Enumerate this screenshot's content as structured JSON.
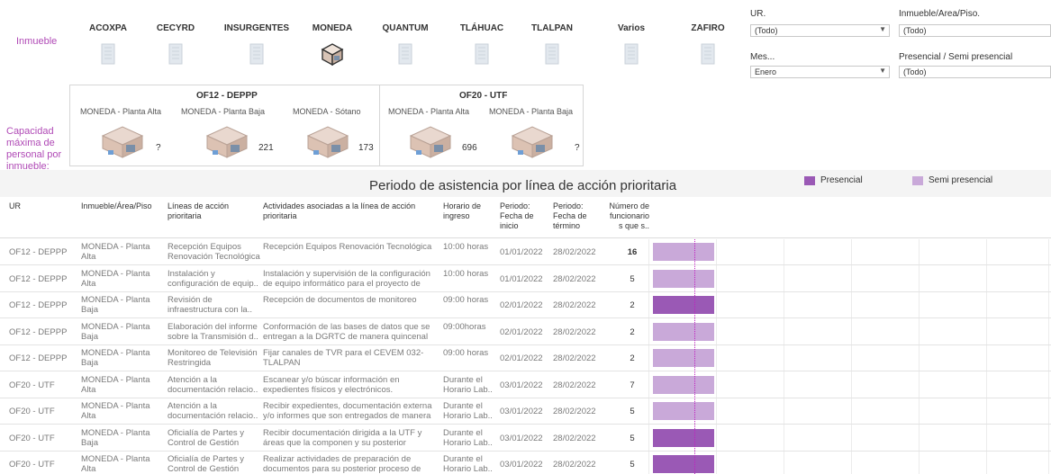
{
  "inmueble": {
    "label": "Inmueble",
    "buildings": [
      {
        "name": "ACOXPA",
        "icon": "building-icon",
        "selected": false
      },
      {
        "name": "CECYRD",
        "icon": "tower-icon",
        "selected": false
      },
      {
        "name": "INSURGENTES",
        "icon": "office-buildings-icon",
        "selected": false
      },
      {
        "name": "MONEDA",
        "icon": "building-block-icon",
        "selected": true
      },
      {
        "name": "QUANTUM",
        "icon": "building-icon",
        "selected": false
      },
      {
        "name": "TLÁHUAC",
        "icon": "dome-building-icon",
        "selected": false
      },
      {
        "name": "TLALPAN",
        "icon": "stacked-building-icon",
        "selected": false
      },
      {
        "name": "Varios",
        "icon": "city-icon",
        "selected": false
      },
      {
        "name": "ZAFIRO",
        "icon": "glass-tower-icon",
        "selected": false
      }
    ]
  },
  "filters": {
    "ur": {
      "label": "UR.",
      "value": "(Todo)"
    },
    "inmueble_area": {
      "label": "Inmueble/Area/Piso.",
      "value": "(Todo)"
    },
    "mes": {
      "label": "Mes...",
      "value": "Enero"
    },
    "presencial": {
      "label": "Presencial / Semi presencial",
      "value": "(Todo)"
    }
  },
  "capacity": {
    "label": "Capacidad máxima de personal por inmueble:",
    "groups": [
      {
        "title": "OF12 - DEPPP",
        "items": [
          {
            "name": "MONEDA - Planta Alta",
            "value": "?"
          },
          {
            "name": "MONEDA - Planta Baja",
            "value": "221"
          },
          {
            "name": "MONEDA - Sótano",
            "value": "173"
          }
        ]
      },
      {
        "title": "OF20 - UTF",
        "items": [
          {
            "name": "MONEDA - Planta Alta",
            "value": "696"
          },
          {
            "name": "MONEDA - Planta Baja",
            "value": "?"
          }
        ]
      }
    ]
  },
  "section": {
    "title": "Periodo de asistencia por línea de acción prioritaria",
    "legend": [
      {
        "label": "Presencial",
        "color": "#9a59b5"
      },
      {
        "label": "Semi presencial",
        "color": "#c9a9d9"
      }
    ]
  },
  "table": {
    "headers": {
      "ur": "UR",
      "inmueble": "Inmueble/Área/Piso",
      "lineas": "Líneas de acción prioritaria",
      "actividades": "Actividades asociadas a la línea de acción prioritaria",
      "horario": "Horario de ingreso",
      "inicio": "Periodo: Fecha de inicio",
      "termino": "Periodo: Fecha de término",
      "numero": "Número de funcionario s que s.."
    },
    "rows": [
      {
        "ur": "OF12 - DEPPP",
        "inmueble": "MONEDA - Planta Alta",
        "linea": "Recepción Equipos Renovación Tecnológica",
        "actividad": "Recepción Equipos Renovación Tecnológica",
        "horario": "10:00 horas",
        "inicio": "01/01/2022",
        "termino": "28/02/2022",
        "numero": "16",
        "numero_bold": true,
        "type": "Semi presencial"
      },
      {
        "ur": "OF12 - DEPPP",
        "inmueble": "MONEDA - Planta Alta",
        "linea": "Instalación y configuración de equip..",
        "actividad": "Instalación y supervisión de la configuración de equipo informático para el proyecto de DRP",
        "horario": "10:00 horas",
        "inicio": "01/01/2022",
        "termino": "28/02/2022",
        "numero": "5",
        "numero_bold": false,
        "type": "Semi presencial"
      },
      {
        "ur": "OF12 - DEPPP",
        "inmueble": "MONEDA - Planta Baja",
        "linea": " Revisión de infraestructura con la..",
        "actividad": "Recepción de documentos de monitoreo",
        "horario": "09:00 horas",
        "inicio": "02/01/2022",
        "termino": "28/02/2022",
        "numero": "2",
        "numero_bold": false,
        "type": "Presencial"
      },
      {
        "ur": "OF12 - DEPPP",
        "inmueble": "MONEDA - Planta Baja",
        "linea": "Elaboración del informe sobre la Transmisión d..",
        "actividad": "Conformación de las bases de datos que se entregan a la DGRTC de manera quincenal",
        "horario": "09:00horas",
        "inicio": "02/01/2022",
        "termino": "28/02/2022",
        "numero": "2",
        "numero_bold": false,
        "type": "Semi presencial"
      },
      {
        "ur": "OF12 - DEPPP",
        "inmueble": "MONEDA - Planta Baja",
        "linea": "Monitoreo de Televisión Restringida",
        "actividad": "Fijar canales de TVR para el CEVEM 032-TLALPAN",
        "horario": "09:00 horas",
        "inicio": "02/01/2022",
        "termino": "28/02/2022",
        "numero": "2",
        "numero_bold": false,
        "type": "Semi presencial"
      },
      {
        "ur": "OF20 - UTF",
        "inmueble": "MONEDA - Planta Alta",
        "linea": "Atención a la documentación relacio..",
        "actividad": "Escanear y/o búscar información en expedientes físicos y electrónicos.",
        "horario": "Durante el Horario Lab..",
        "inicio": "03/01/2022",
        "termino": "28/02/2022",
        "numero": "7",
        "numero_bold": false,
        "type": "Semi presencial"
      },
      {
        "ur": "OF20 - UTF",
        "inmueble": "MONEDA - Planta Alta",
        "linea": "Atención a la documentación relacio..",
        "actividad": "Recibir expedientes, documentación externa y/o informes que son entregados de manera física po..",
        "horario": "Durante el Horario Lab..",
        "inicio": "03/01/2022",
        "termino": "28/02/2022",
        "numero": "5",
        "numero_bold": false,
        "type": "Semi presencial"
      },
      {
        "ur": "OF20 - UTF",
        "inmueble": "MONEDA - Planta Baja",
        "linea": "Oficialía de Partes y Control de Gestión",
        "actividad": "Recibir documentación dirigida a la UTF y áreas que la componen y su posterior entrega.",
        "horario": "Durante el Horario Lab..",
        "inicio": "03/01/2022",
        "termino": "28/02/2022",
        "numero": "5",
        "numero_bold": false,
        "type": "Presencial"
      },
      {
        "ur": "OF20 - UTF",
        "inmueble": "MONEDA - Planta Alta",
        "linea": "Oficialía de Partes y Control de Gestión",
        "actividad": "Realizar actividades de preparación de documentos para su posterior proceso de mensaj..",
        "horario": "Durante el Horario Lab..",
        "inicio": "03/01/2022",
        "termino": "28/02/2022",
        "numero": "5",
        "numero_bold": false,
        "type": "Presencial"
      }
    ]
  }
}
